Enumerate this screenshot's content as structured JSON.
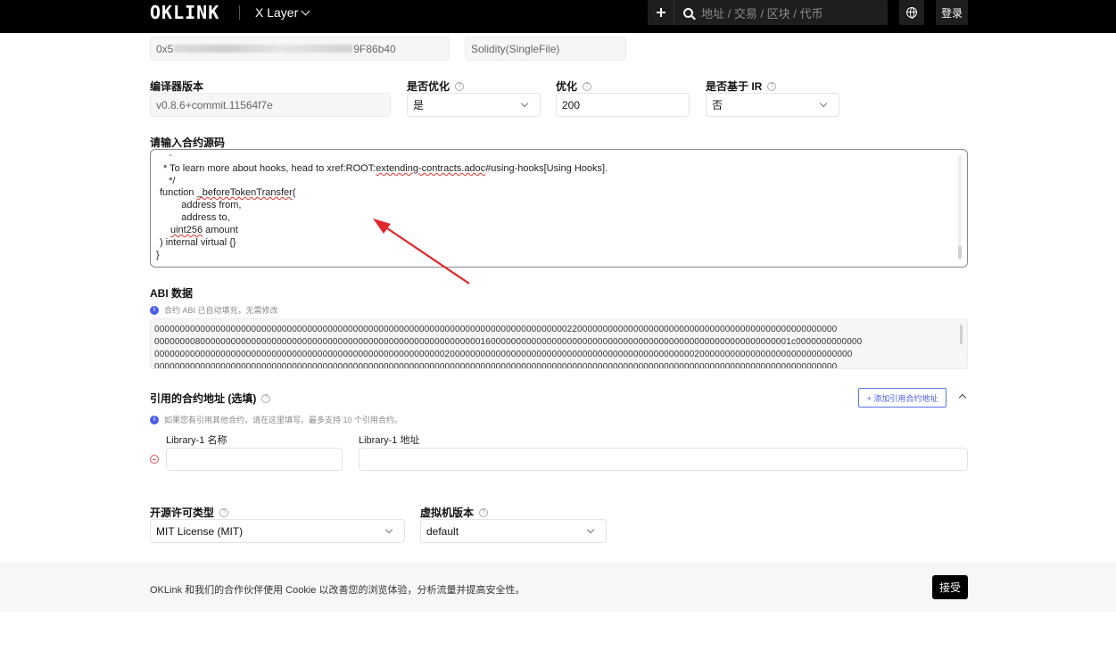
{
  "header": {
    "logo": "OKLINK",
    "chain": "X Layer",
    "search_placeholder": "地址 / 交易 / 区块 / 代币",
    "login": "登录"
  },
  "top_fields": {
    "address_prefix": "0x5",
    "address_suffix": "9F86b40",
    "compiler_type": "Solidity(SingleFile)"
  },
  "compiler": {
    "version_label": "编译器版本",
    "version_value": "v0.8.6+commit.11564f7e",
    "optimize_label": "是否优化",
    "optimize_value": "是",
    "runs_label": "优化",
    "runs_value": "200",
    "via_ir_label": "是否基于 IR",
    "via_ir_value": "否"
  },
  "source": {
    "label": "请输入合约源码",
    "lines": [
      "  -",
      "  * To learn more about hooks, head to xref:ROOT:extending-contracts.adoc#using-hooks[Using Hooks].",
      "  */",
      "function _beforeTokenTransfer(",
      "    address from,",
      "    address to,",
      "    uint256 amount",
      ") internal virtual {}",
      "}"
    ]
  },
  "abi": {
    "label": "ABI 数据",
    "hint": "合约 ABI 已自动填充，无需修改",
    "lines": [
      "00000000000000000000000000000000000000000000000000000000000000000000000000000000022000000000000000000000000000000000000000000000000000",
      "00000000800000000000000000000000000000000000000000000000000000001600000000000000000000000000000000000000000000000000000000001c0000000000000",
      "00000000000000000000000000000000000000000000000000000000020000000000000000000000000000000000000000000000002000000000000000000000000000000",
      "00000000000000000000000000000000000000000000000000000000000000000000000000000000000000000000000000000000000000000000000000000000000000"
    ]
  },
  "libraries": {
    "label": "引用的合约地址 (选填)",
    "add_button": "+ 添加引用合约地址",
    "hint": "如果您有引用其他合约，请在这里填写。最多支持 10 个引用合约。",
    "name_label": "Library-1 名称",
    "address_label": "Library-1 地址"
  },
  "license": {
    "label": "开源许可类型",
    "value": "MIT License (MIT)",
    "vm_label": "虚拟机版本",
    "vm_value": "default"
  },
  "cookie": {
    "text": "OKLink 和我们的合作伙伴使用 Cookie 以改善您的浏览体验，分析流量并提高安全性。",
    "accept": "接受"
  },
  "colors": {
    "accent": "#4c5de7",
    "arrow": "#e0282e"
  }
}
